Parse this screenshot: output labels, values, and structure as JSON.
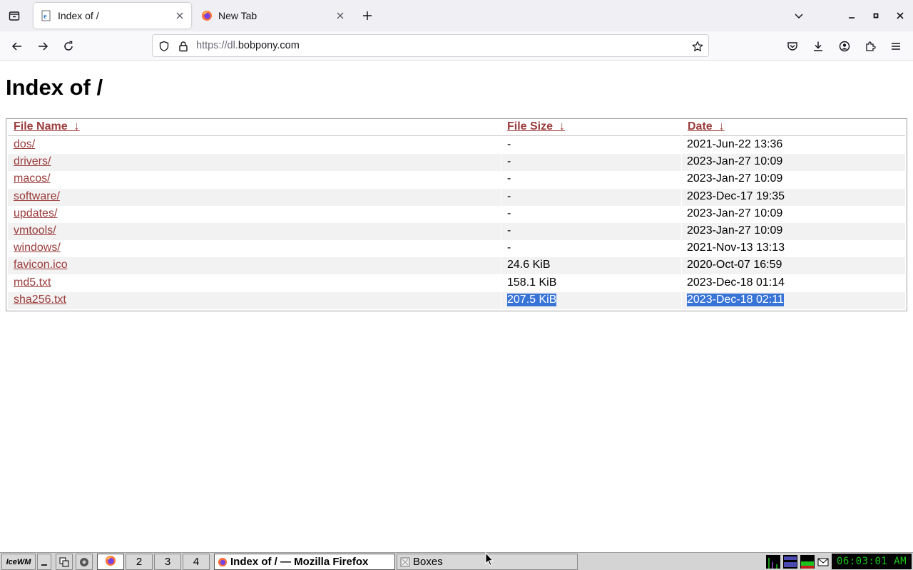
{
  "browser": {
    "tabs": [
      {
        "title": "Index of /",
        "active": true,
        "icon": "ie-page-icon"
      },
      {
        "title": "New Tab",
        "active": false,
        "icon": "firefox-icon"
      }
    ],
    "url_prefix": "https://dl.",
    "url_domain": "bobpony.com"
  },
  "page": {
    "title": "Index of /",
    "columns": {
      "name": "File Name",
      "size": "File Size",
      "date": "Date",
      "sort_arrow": "↓"
    },
    "rows": [
      {
        "name": "dos/",
        "size": "-",
        "date": "2021-Jun-22 13:36"
      },
      {
        "name": "drivers/",
        "size": "-",
        "date": "2023-Jan-27 10:09"
      },
      {
        "name": "macos/",
        "size": "-",
        "date": "2023-Jan-27 10:09"
      },
      {
        "name": "software/",
        "size": "-",
        "date": "2023-Dec-17 19:35"
      },
      {
        "name": "updates/",
        "size": "-",
        "date": "2023-Jan-27 10:09"
      },
      {
        "name": "vmtools/",
        "size": "-",
        "date": "2023-Jan-27 10:09"
      },
      {
        "name": "windows/",
        "size": "-",
        "date": "2021-Nov-13 13:13"
      },
      {
        "name": "favicon.ico",
        "size": "24.6 KiB",
        "date": "2020-Oct-07 16:59"
      },
      {
        "name": "md5.txt",
        "size": "158.1 KiB",
        "date": "2023-Dec-18 01:14"
      },
      {
        "name": "sha256.txt",
        "size": "207.5 KiB",
        "date": "2023-Dec-18 02:11",
        "selected": true
      }
    ]
  },
  "taskbar": {
    "start_label": "IceWM",
    "workspaces": [
      "1",
      "2",
      "3",
      "4"
    ],
    "active_workspace": "1",
    "tasks": [
      {
        "title": "Index of / — Mozilla Firefox",
        "active": true
      },
      {
        "title": "Boxes",
        "active": false
      }
    ],
    "clock": "06:03:01 AM"
  },
  "colors": {
    "link": "#9b3b3b",
    "selection": "#3873d6",
    "clock_text": "#19c719"
  }
}
